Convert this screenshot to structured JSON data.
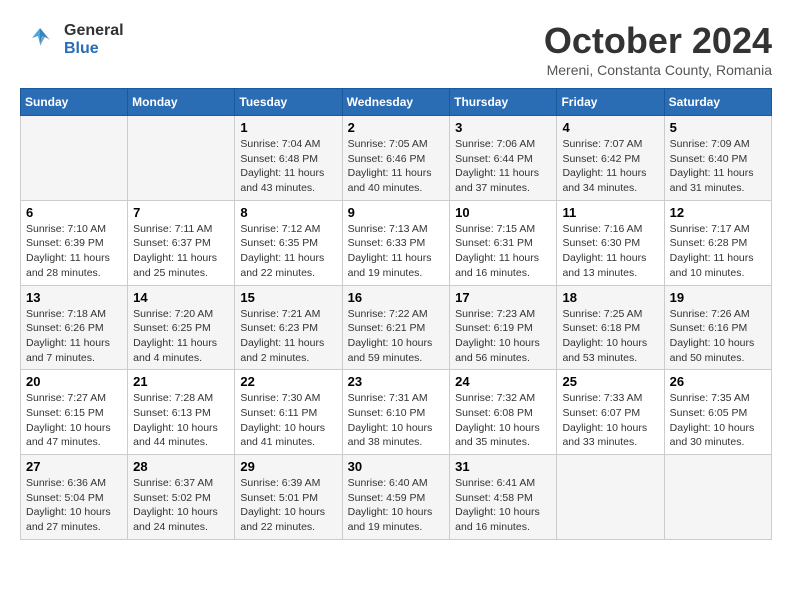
{
  "header": {
    "logo_general": "General",
    "logo_blue": "Blue",
    "month_title": "October 2024",
    "location": "Mereni, Constanta County, Romania"
  },
  "days_of_week": [
    "Sunday",
    "Monday",
    "Tuesday",
    "Wednesday",
    "Thursday",
    "Friday",
    "Saturday"
  ],
  "weeks": [
    [
      {
        "day": "",
        "info": ""
      },
      {
        "day": "",
        "info": ""
      },
      {
        "day": "1",
        "info": "Sunrise: 7:04 AM\nSunset: 6:48 PM\nDaylight: 11 hours and 43 minutes."
      },
      {
        "day": "2",
        "info": "Sunrise: 7:05 AM\nSunset: 6:46 PM\nDaylight: 11 hours and 40 minutes."
      },
      {
        "day": "3",
        "info": "Sunrise: 7:06 AM\nSunset: 6:44 PM\nDaylight: 11 hours and 37 minutes."
      },
      {
        "day": "4",
        "info": "Sunrise: 7:07 AM\nSunset: 6:42 PM\nDaylight: 11 hours and 34 minutes."
      },
      {
        "day": "5",
        "info": "Sunrise: 7:09 AM\nSunset: 6:40 PM\nDaylight: 11 hours and 31 minutes."
      }
    ],
    [
      {
        "day": "6",
        "info": "Sunrise: 7:10 AM\nSunset: 6:39 PM\nDaylight: 11 hours and 28 minutes."
      },
      {
        "day": "7",
        "info": "Sunrise: 7:11 AM\nSunset: 6:37 PM\nDaylight: 11 hours and 25 minutes."
      },
      {
        "day": "8",
        "info": "Sunrise: 7:12 AM\nSunset: 6:35 PM\nDaylight: 11 hours and 22 minutes."
      },
      {
        "day": "9",
        "info": "Sunrise: 7:13 AM\nSunset: 6:33 PM\nDaylight: 11 hours and 19 minutes."
      },
      {
        "day": "10",
        "info": "Sunrise: 7:15 AM\nSunset: 6:31 PM\nDaylight: 11 hours and 16 minutes."
      },
      {
        "day": "11",
        "info": "Sunrise: 7:16 AM\nSunset: 6:30 PM\nDaylight: 11 hours and 13 minutes."
      },
      {
        "day": "12",
        "info": "Sunrise: 7:17 AM\nSunset: 6:28 PM\nDaylight: 11 hours and 10 minutes."
      }
    ],
    [
      {
        "day": "13",
        "info": "Sunrise: 7:18 AM\nSunset: 6:26 PM\nDaylight: 11 hours and 7 minutes."
      },
      {
        "day": "14",
        "info": "Sunrise: 7:20 AM\nSunset: 6:25 PM\nDaylight: 11 hours and 4 minutes."
      },
      {
        "day": "15",
        "info": "Sunrise: 7:21 AM\nSunset: 6:23 PM\nDaylight: 11 hours and 2 minutes."
      },
      {
        "day": "16",
        "info": "Sunrise: 7:22 AM\nSunset: 6:21 PM\nDaylight: 10 hours and 59 minutes."
      },
      {
        "day": "17",
        "info": "Sunrise: 7:23 AM\nSunset: 6:19 PM\nDaylight: 10 hours and 56 minutes."
      },
      {
        "day": "18",
        "info": "Sunrise: 7:25 AM\nSunset: 6:18 PM\nDaylight: 10 hours and 53 minutes."
      },
      {
        "day": "19",
        "info": "Sunrise: 7:26 AM\nSunset: 6:16 PM\nDaylight: 10 hours and 50 minutes."
      }
    ],
    [
      {
        "day": "20",
        "info": "Sunrise: 7:27 AM\nSunset: 6:15 PM\nDaylight: 10 hours and 47 minutes."
      },
      {
        "day": "21",
        "info": "Sunrise: 7:28 AM\nSunset: 6:13 PM\nDaylight: 10 hours and 44 minutes."
      },
      {
        "day": "22",
        "info": "Sunrise: 7:30 AM\nSunset: 6:11 PM\nDaylight: 10 hours and 41 minutes."
      },
      {
        "day": "23",
        "info": "Sunrise: 7:31 AM\nSunset: 6:10 PM\nDaylight: 10 hours and 38 minutes."
      },
      {
        "day": "24",
        "info": "Sunrise: 7:32 AM\nSunset: 6:08 PM\nDaylight: 10 hours and 35 minutes."
      },
      {
        "day": "25",
        "info": "Sunrise: 7:33 AM\nSunset: 6:07 PM\nDaylight: 10 hours and 33 minutes."
      },
      {
        "day": "26",
        "info": "Sunrise: 7:35 AM\nSunset: 6:05 PM\nDaylight: 10 hours and 30 minutes."
      }
    ],
    [
      {
        "day": "27",
        "info": "Sunrise: 6:36 AM\nSunset: 5:04 PM\nDaylight: 10 hours and 27 minutes."
      },
      {
        "day": "28",
        "info": "Sunrise: 6:37 AM\nSunset: 5:02 PM\nDaylight: 10 hours and 24 minutes."
      },
      {
        "day": "29",
        "info": "Sunrise: 6:39 AM\nSunset: 5:01 PM\nDaylight: 10 hours and 22 minutes."
      },
      {
        "day": "30",
        "info": "Sunrise: 6:40 AM\nSunset: 4:59 PM\nDaylight: 10 hours and 19 minutes."
      },
      {
        "day": "31",
        "info": "Sunrise: 6:41 AM\nSunset: 4:58 PM\nDaylight: 10 hours and 16 minutes."
      },
      {
        "day": "",
        "info": ""
      },
      {
        "day": "",
        "info": ""
      }
    ]
  ]
}
